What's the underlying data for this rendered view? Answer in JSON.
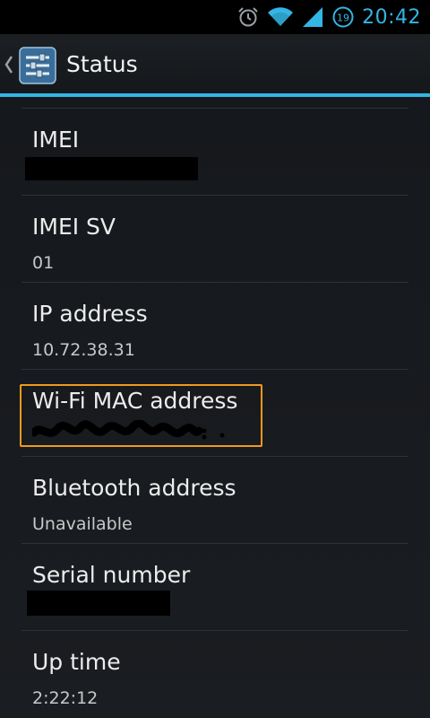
{
  "status_bar": {
    "time": "20:42",
    "icons": [
      "alarm-icon",
      "wifi-icon",
      "signal-icon",
      "battery-icon"
    ],
    "battery_level": "19"
  },
  "action_bar": {
    "title": "Status",
    "app_icon": "settings-sliders-icon",
    "up_icon": "chevron-left-icon"
  },
  "items": [
    {
      "title": "IMEI",
      "value": ""
    },
    {
      "title": "IMEI SV",
      "value": "01"
    },
    {
      "title": "IP address",
      "value": "10.72.38.31"
    },
    {
      "title": "Wi-Fi MAC address",
      "value": ""
    },
    {
      "title": "Bluetooth address",
      "value": "Unavailable"
    },
    {
      "title": "Serial number",
      "value": ""
    },
    {
      "title": "Up time",
      "value": "2:22:12"
    }
  ],
  "colors": {
    "accent": "#33b5e5",
    "highlight": "#ef9a1e",
    "background": "#15181c"
  }
}
